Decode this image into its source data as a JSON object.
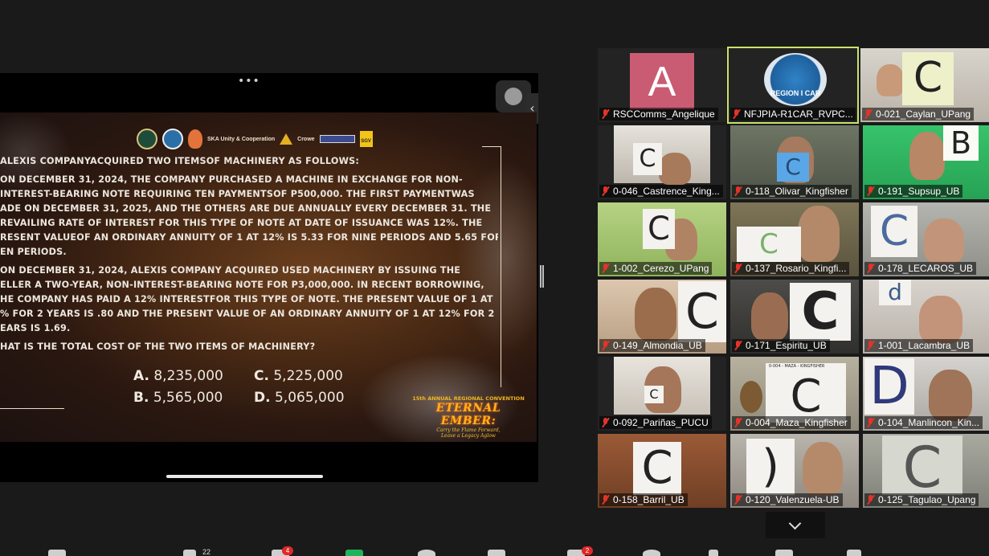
{
  "share": {
    "more_dots": "•••",
    "collapse_glyph": "‹",
    "slide": {
      "intro": "ALEXIS COMPANYACQUIRED TWO ITEMSOF MACHINERY AS FOLLOWS:",
      "para1_lines": [
        "ON DECEMBER 31, 2024, THE COMPANY PURCHASED A MACHINE IN EXCHANGE FOR NON-",
        "INTEREST-BEARING NOTE REQUIRING TEN PAYMENTSOF P500,000. THE FIRST PAYMENTWAS",
        "ADE ON DECEMBER 31, 2025, AND THE OTHERS ARE DUE ANNUALLY EVERY DECEMBER 31. THE",
        "REVAILING RATE OF INTEREST FOR THIS TYPE OF NOTE AT DATE OF ISSUANCE WAS 12%. THE",
        "RESENT VALUEOF AN ORDINARY ANNUITY OF 1 AT 12% IS 5.33 FOR NINE PERIODS AND 5.65 FOR",
        "EN PERIODS."
      ],
      "para2_lines": [
        "ON DECEMBER 31, 2024, ALEXIS COMPANY ACQUIRED USED MACHINERY BY ISSUING THE",
        "ELLER A TWO-YEAR, NON-INTEREST-BEARING NOTE FOR P3,000,000. IN RECENT BORROWING,",
        "HE COMPANY HAS PAID A 12% INTERESTFOR THIS TYPE OF NOTE. THE PRESENT VALUE OF 1 AT",
        "% FOR 2 YEARS IS .80 AND THE PRESENT VALUE OF AN ORDINARY ANNUITY OF 1 AT 12% FOR 2",
        "EARS IS 1.69."
      ],
      "question": "HAT IS THE TOTAL COST OF THE TWO ITEMS OF MACHINERY?",
      "answers": [
        {
          "letter": "A.",
          "value": "8,235,000"
        },
        {
          "letter": "C.",
          "value": "5,225,000"
        },
        {
          "letter": "B.",
          "value": "5,565,000"
        },
        {
          "letter": "D.",
          "value": "5,065,000"
        }
      ],
      "logos_text": {
        "ska": "SKA Unity & Cooperation",
        "crowe": "Crowe",
        "sgv": "SGV"
      },
      "convention": {
        "line1": "15th ANNUAL REGIONAL CONVENTION",
        "line2": "ETERNAL EMBER:",
        "line3a": "Carry the Flame Forward,",
        "line3b": "Leave a Legacy Aglow"
      }
    }
  },
  "participants": [
    {
      "name": "RSCComms_Angelique",
      "avatar_letter": "A",
      "card": ""
    },
    {
      "name": "NFJPIA-R1CAR_RVPC...",
      "badge_text": "REGION I CAR",
      "active": true,
      "card": ""
    },
    {
      "name": "0-021_Caylan_UPang",
      "card": "C"
    },
    {
      "name": "0-046_Castrence_King...",
      "card": "C"
    },
    {
      "name": "0-118_Olivar_Kingfisher",
      "card": "C"
    },
    {
      "name": "0-191_Supsup_UB",
      "card": "B"
    },
    {
      "name": "1-002_Cerezo_UPang",
      "card": "C"
    },
    {
      "name": "0-137_Rosario_Kingfi...",
      "card": "C"
    },
    {
      "name": "0-178_LECAROS_UB",
      "card": "C"
    },
    {
      "name": "0-149_Almondia_UB",
      "card": "C"
    },
    {
      "name": "0-171_Espiritu_UB",
      "card": "C"
    },
    {
      "name": "1-001_Lacambra_UB",
      "card": "d"
    },
    {
      "name": "0-092_Pariñas_PUCU",
      "card": "C"
    },
    {
      "name": "0-004_Maza_Kingfisher",
      "card": "C",
      "card_header": "0-004 - MAZA - KINGFISHER"
    },
    {
      "name": "0-104_Manlincon_Kin...",
      "card": "D"
    },
    {
      "name": "0-158_Barril_UB",
      "card": "C"
    },
    {
      "name": "0-120_Valenzuela-UB",
      "card": ")"
    },
    {
      "name": "0-125_Tagulao_Upang",
      "card": "C"
    }
  ],
  "toolbar": {
    "participants_count": "22",
    "chat_badge": "4",
    "apps_badge": "2"
  },
  "colors": {
    "active_speaker": "#c9e36b",
    "muted_icon": "#e5332a",
    "badge": "#e02828"
  }
}
